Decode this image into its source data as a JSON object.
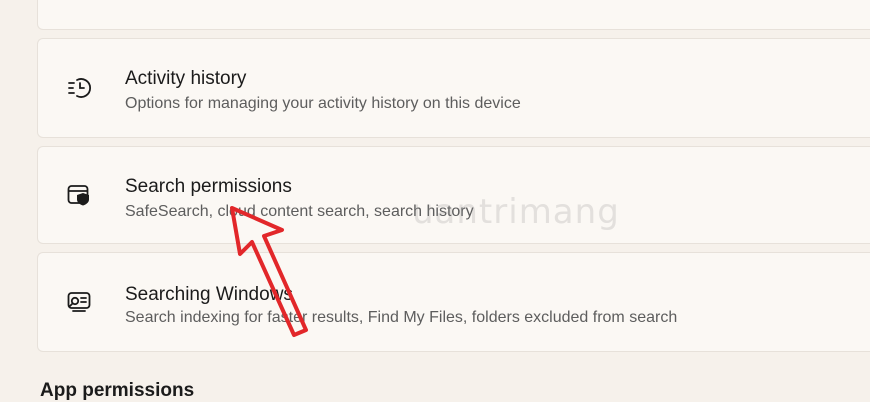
{
  "cards": {
    "top_partial": {
      "subtitle": ""
    },
    "activity_history": {
      "title": "Activity history",
      "subtitle": "Options for managing your activity history on this device",
      "icon": "activity-history-icon"
    },
    "search_permissions": {
      "title": "Search permissions",
      "subtitle": "SafeSearch, cloud content search, search history",
      "icon": "search-permissions-icon"
    },
    "searching_windows": {
      "title": "Searching Windows",
      "subtitle": "Search indexing for faster results, Find My Files, folders excluded from search",
      "icon": "searching-windows-icon"
    }
  },
  "section": {
    "heading": "App permissions"
  },
  "watermark": {
    "text": "uantrimang"
  },
  "colors": {
    "background": "#f6f1eb",
    "card": "#fbf8f4",
    "arrow": "#e2272a"
  }
}
